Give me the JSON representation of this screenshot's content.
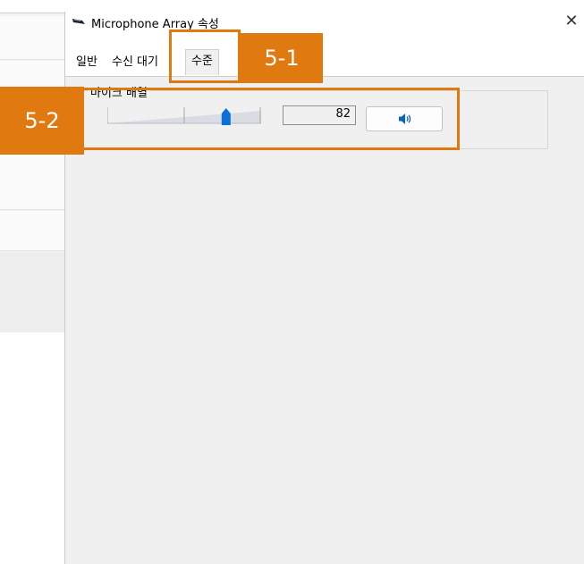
{
  "window": {
    "title": "Microphone Array 속성",
    "close_glyph": "✕"
  },
  "tabs": [
    {
      "label": "일반",
      "active": false
    },
    {
      "label": "수신 대기",
      "active": false
    },
    {
      "label": "수준",
      "active": true
    }
  ],
  "levels": {
    "group_label": "마이크 배열",
    "volume_value": "82",
    "volume_level_percent": 82,
    "mute_icon": "speaker-icon"
  },
  "annotations": [
    {
      "label": "5-1"
    },
    {
      "label": "5-2"
    }
  ],
  "colors": {
    "annotation": "#e07a10",
    "slider_thumb": "#0a6fd6",
    "dialog_bg": "#f0f0f0"
  }
}
